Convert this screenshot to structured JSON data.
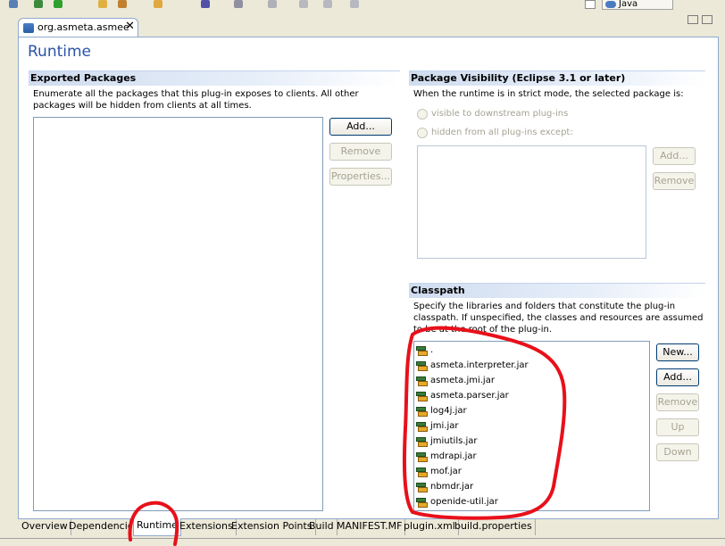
{
  "perspective": {
    "label": "Java"
  },
  "editor_tab": {
    "title": "org.asmeta.asmee",
    "close": "✕"
  },
  "page_title": "Runtime",
  "exported_packages": {
    "title": "Exported Packages",
    "description": "Enumerate all the packages that this plug-in exposes to clients.  All other packages will be hidden from clients at all times.",
    "buttons": {
      "add": "Add...",
      "remove": "Remove",
      "properties": "Properties..."
    }
  },
  "package_visibility": {
    "title": "Package Visibility (Eclipse 3.1 or later)",
    "description": "When the runtime is in strict mode, the selected package is:",
    "options": {
      "visible": "visible to downstream plug-ins",
      "hidden": "hidden from all plug-ins except:"
    },
    "buttons": {
      "add": "Add...",
      "remove": "Remove"
    }
  },
  "classpath": {
    "title": "Classpath",
    "description": "Specify the libraries and folders that constitute the plug-in classpath.  If unspecified, the classes and resources are assumed to be at the root of the plug-in.",
    "items": [
      ".",
      "asmeta.interpreter.jar",
      "asmeta.jmi.jar",
      "asmeta.parser.jar",
      "log4j.jar",
      "jmi.jar",
      "jmiutils.jar",
      "mdrapi.jar",
      "mof.jar",
      "nbmdr.jar",
      "openide-util.jar"
    ],
    "buttons": {
      "new": "New...",
      "add": "Add...",
      "remove": "Remove",
      "up": "Up",
      "down": "Down"
    }
  },
  "bottom_tabs": [
    "Overview",
    "Dependencies",
    "Runtime",
    "Extensions",
    "Extension Points",
    "Build",
    "MANIFEST.MF",
    "plugin.xml",
    "build.properties"
  ],
  "colors": {
    "title_blue": "#2a53a8",
    "annotation_red": "#e8101a",
    "section_header": "#cfdcef"
  }
}
